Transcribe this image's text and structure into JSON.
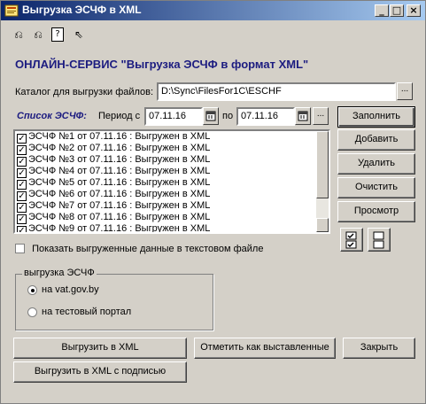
{
  "window": {
    "title": "Выгрузка ЭСЧФ в XML",
    "controls": {
      "minimize": "_",
      "maximize": "□",
      "close": "×"
    }
  },
  "toolbar": {
    "icons": [
      "save-icon",
      "load-icon",
      "help-icon",
      "context-help-icon"
    ],
    "glyphs": {
      "save": "⎌",
      "load": "⎌",
      "help": "?",
      "context_help": "⇖"
    }
  },
  "heading": "ОНЛАЙН-СЕРВИС \"Выгрузка ЭСЧФ в формат XML\"",
  "catalog": {
    "label": "Каталог для выгрузки файлов:",
    "value": "D:\\Sync\\FilesFor1C\\ESCHF",
    "browse_label": "..."
  },
  "list": {
    "label": "Список ЭСЧФ:",
    "period_label": "Период с",
    "date_from": "07.11.16",
    "to_label": "по",
    "date_to": "07.11.16",
    "period_button": "...",
    "items": [
      {
        "text": "ЭСЧФ №1 от 07.11.16 : Выгружен в XML",
        "checked": true
      },
      {
        "text": "ЭСЧФ №2 от 07.11.16 : Выгружен в XML",
        "checked": true
      },
      {
        "text": "ЭСЧФ №3 от 07.11.16 : Выгружен в XML",
        "checked": true
      },
      {
        "text": "ЭСЧФ №4 от 07.11.16 : Выгружен в XML",
        "checked": true
      },
      {
        "text": "ЭСЧФ №5 от 07.11.16 : Выгружен в XML",
        "checked": true
      },
      {
        "text": "ЭСЧФ №6 от 07.11.16 : Выгружен в XML",
        "checked": true
      },
      {
        "text": "ЭСЧФ №7 от 07.11.16 : Выгружен в XML",
        "checked": true
      },
      {
        "text": "ЭСЧФ №8 от 07.11.16 : Выгружен в XML",
        "checked": true
      },
      {
        "text": "ЭСЧФ №9 от 07.11.16 : Выгружен в XML",
        "checked": true
      }
    ]
  },
  "side_buttons": {
    "fill": "Заполнить",
    "add": "Добавить",
    "delete": "Удалить",
    "clear": "Очистить",
    "preview": "Просмотр"
  },
  "show_text_checkbox": {
    "label": "Показать выгруженные данные в текстовом файле",
    "checked": false
  },
  "upload_group": {
    "title": "выгрузка ЭСЧФ",
    "options": [
      {
        "label": "на vat.gov.by",
        "selected": true
      },
      {
        "label": "на тестовый портал",
        "selected": false
      }
    ]
  },
  "bottom_buttons": {
    "export_xml": "Выгрузить в XML",
    "mark_issued": "Отметить как выставленные",
    "close": "Закрыть",
    "export_signed": "Выгрузить в XML с подписью"
  }
}
